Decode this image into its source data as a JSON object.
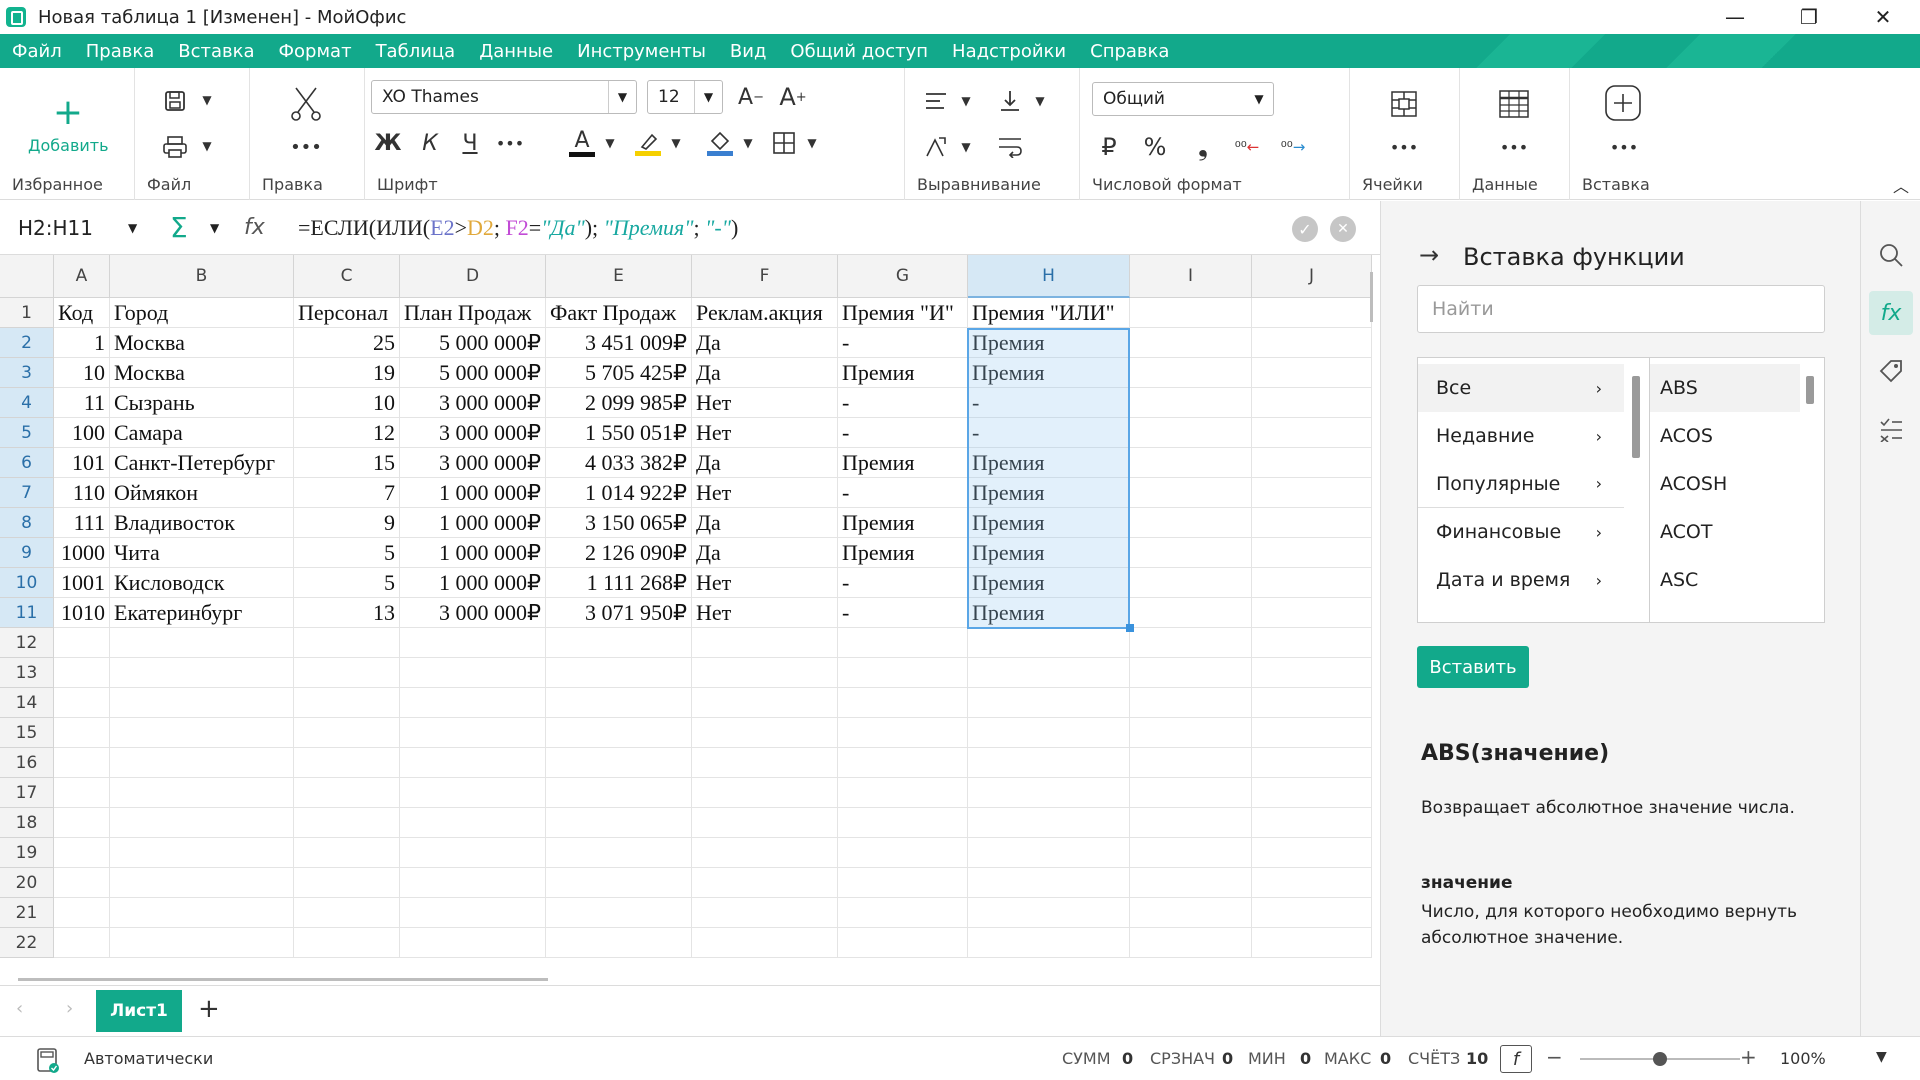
{
  "window": {
    "title": "Новая таблица 1 [Изменен] - МойОфис",
    "minimize": "—",
    "maximize": "❐",
    "close": "✕"
  },
  "menu": [
    "Файл",
    "Правка",
    "Вставка",
    "Формат",
    "Таблица",
    "Данные",
    "Инструменты",
    "Вид",
    "Общий доступ",
    "Надстройки",
    "Справка"
  ],
  "ribbon": {
    "add_label": "Добавить",
    "groups": {
      "favorites": "Избранное",
      "file": "Файл",
      "edit": "Правка",
      "font": "Шрифт",
      "align": "Выравнивание",
      "numfmt": "Числовой формат",
      "cells": "Ячейки",
      "data": "Данные",
      "insert": "Вставка"
    },
    "font_name": "XO Thames",
    "font_size": "12",
    "number_format": "Общий",
    "bold": "Ж",
    "italic": "К",
    "underline": "Ч",
    "currency": "₽",
    "percent": "%",
    "font_color": "#111111",
    "highlight_color": "#f5d000",
    "fill_color": "#3a7fd0"
  },
  "formula_bar": {
    "cell_ref": "H2:H11",
    "formula_parts": [
      "=ЕСЛИ(ИЛИ(",
      "E2",
      ">",
      "D2",
      "; ",
      "F2",
      "=",
      "\"Да\"",
      "); ",
      "\"Премия\"",
      "; ",
      "\"-\"",
      ")"
    ]
  },
  "sheet": {
    "columns": [
      "A",
      "B",
      "C",
      "D",
      "E",
      "F",
      "G",
      "H",
      "I",
      "J"
    ],
    "selected_column": "H",
    "rows": [
      "1",
      "2",
      "3",
      "4",
      "5",
      "6",
      "7",
      "8",
      "9",
      "10",
      "11",
      "12",
      "13",
      "14",
      "15",
      "16",
      "17",
      "18",
      "19",
      "20",
      "21",
      "22"
    ],
    "selected_rows": [
      "2",
      "3",
      "4",
      "5",
      "6",
      "7",
      "8",
      "9",
      "10",
      "11"
    ],
    "header": [
      "Код",
      "Город",
      "Персонал",
      "План Продаж",
      "Факт Продаж",
      "Реклам.акция",
      "Премия \"И\"",
      "Премия \"ИЛИ\""
    ],
    "data": [
      [
        "1",
        "Москва",
        "25",
        "5 000 000₽",
        "3 451 009₽",
        "Да",
        "-",
        "Премия"
      ],
      [
        "10",
        "Москва",
        "19",
        "5 000 000₽",
        "5 705 425₽",
        "Да",
        "Премия",
        "Премия"
      ],
      [
        "11",
        "Сызрань",
        "10",
        "3 000 000₽",
        "2 099 985₽",
        "Нет",
        "-",
        "-"
      ],
      [
        "100",
        "Самара",
        "12",
        "3 000 000₽",
        "1 550 051₽",
        "Нет",
        "-",
        "-"
      ],
      [
        "101",
        "Санкт-Петербург",
        "15",
        "3 000 000₽",
        "4 033 382₽",
        "Да",
        "Премия",
        "Премия"
      ],
      [
        "110",
        "Оймякон",
        "7",
        "1 000 000₽",
        "1 014 922₽",
        "Нет",
        "-",
        "Премия"
      ],
      [
        "111",
        "Владивосток",
        "9",
        "1 000 000₽",
        "3 150 065₽",
        "Да",
        "Премия",
        "Премия"
      ],
      [
        "1000",
        "Чита",
        "5",
        "1 000 000₽",
        "2 126 090₽",
        "Да",
        "Премия",
        "Премия"
      ],
      [
        "1001",
        "Кисловодск",
        "5",
        "1 000 000₽",
        "1 111 268₽",
        "Нет",
        "-",
        "Премия"
      ],
      [
        "1010",
        "Екатеринбург",
        "13",
        "3 000 000₽",
        "3 071 950₽",
        "Нет",
        "-",
        "Премия"
      ]
    ]
  },
  "tabs": {
    "active": "Лист1",
    "add": "+"
  },
  "status": {
    "mode": "Автоматически",
    "sum_label": "СУММ",
    "sum": "0",
    "avg_label": "СРЗНАЧ",
    "avg": "0",
    "min_label": "МИН",
    "min": "0",
    "max_label": "МАКС",
    "max": "0",
    "count_label": "СЧЁТЗ",
    "count": "10",
    "zoom": "100%",
    "zoom_level": 0.5
  },
  "panel": {
    "title": "Вставка функции",
    "search_placeholder": "Найти",
    "categories": [
      "Все",
      "Недавние",
      "Популярные",
      "Финансовые",
      "Дата и время"
    ],
    "functions": [
      "ABS",
      "ACOS",
      "ACOSH",
      "ACOT",
      "ASC"
    ],
    "insert_label": "Вставить",
    "fn_signature": "ABS(значение)",
    "fn_description": "Возвращает абсолютное значение числа.",
    "arg_name": "значение",
    "arg_description": "Число, для которого необходимо вернуть абсолютное значение."
  },
  "accent": "#12a98b"
}
